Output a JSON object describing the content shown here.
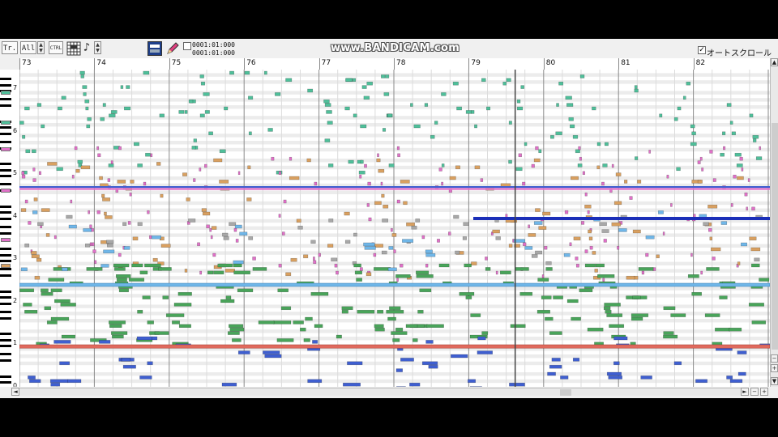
{
  "toolbar": {
    "track_button": "Tr.",
    "track_select": "All",
    "ctrl_label": "CTRL",
    "note_icon": "♪",
    "counter_top": "0001:01:000",
    "counter_bottom": "0001:01:000",
    "watermark": "www.BANDICAM.com",
    "autoscroll_label": "オートスクロール",
    "autoscroll_checked": true
  },
  "ruler": {
    "measures": [
      "73",
      "74",
      "75",
      "76",
      "77",
      "78",
      "79",
      "80",
      "81",
      "82"
    ],
    "first_measure": 73
  },
  "keyboard": {
    "octave_labels": [
      "7",
      "6",
      "5",
      "4",
      "3",
      "2",
      "1",
      "0"
    ]
  },
  "playback": {
    "position_measure": 79.62
  },
  "colors": {
    "teal": "#4fbf9a",
    "pink": "#e070c8",
    "orange": "#d9a060",
    "blue": "#3f5fd0",
    "darkblue": "#1b2fb8",
    "lightblue": "#6fb6e8",
    "green": "#49a45a",
    "red": "#e06a5e",
    "gray": "#a8a8a8"
  },
  "scrollbars": {
    "up": "▲",
    "down": "▼",
    "left": "◄",
    "right": "►",
    "plus": "+",
    "minus": "−"
  }
}
